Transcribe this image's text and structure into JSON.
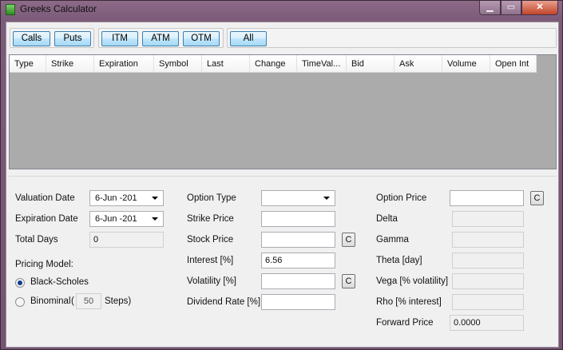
{
  "window": {
    "title": "Greeks Calculator",
    "controls": {
      "minimize": "▁",
      "maximize": "▭",
      "close": "✕"
    }
  },
  "toolbar": {
    "calls": "Calls",
    "puts": "Puts",
    "itm": "ITM",
    "atm": "ATM",
    "otm": "OTM",
    "all": "All"
  },
  "grid": {
    "columns": [
      "Type",
      "Strike",
      "Expiration",
      "Symbol",
      "Last",
      "Change",
      "TimeVal...",
      "Bid",
      "Ask",
      "Volume",
      "Open Int"
    ]
  },
  "form": {
    "valuation_date": {
      "label": "Valuation Date",
      "value": "6-Jun -201"
    },
    "expiration_date": {
      "label": "Expiration Date",
      "value": "6-Jun -201"
    },
    "total_days": {
      "label": "Total Days",
      "value": "0"
    },
    "pricing_model": {
      "label": "Pricing Model:",
      "black_scholes": "Black-Scholes",
      "binominal": "Binominal",
      "paren_open": "(",
      "steps_value": "50",
      "steps_label": "Steps)",
      "selected": "Black-Scholes"
    },
    "option_type": {
      "label": "Option Type",
      "value": ""
    },
    "strike_price": {
      "label": "Strike Price",
      "value": ""
    },
    "stock_price": {
      "label": "Stock Price",
      "value": "",
      "button": "C"
    },
    "interest": {
      "label": "Interest [%]",
      "value": "6.56"
    },
    "volatility": {
      "label": "Volatility [%]",
      "value": "",
      "button": "C"
    },
    "dividend_rate": {
      "label": "Dividend Rate [%]",
      "value": ""
    },
    "option_price": {
      "label": "Option Price",
      "value": "",
      "button": "C"
    },
    "delta": {
      "label": "Delta",
      "value": ""
    },
    "gamma": {
      "label": "Gamma",
      "value": ""
    },
    "theta": {
      "label": "Theta [day]",
      "value": ""
    },
    "vega": {
      "label": "Vega [% volatility]",
      "value": ""
    },
    "rho": {
      "label": "Rho [% interest]",
      "value": ""
    },
    "forward_price": {
      "label": "Forward Price",
      "value": "0.0000"
    }
  },
  "colors": {
    "title_bar": "#7c5c7a",
    "client_bg": "#f0f0f0",
    "grid_bg": "#ababab",
    "button_border": "#3c7fb1",
    "close_button": "#c2442a"
  }
}
